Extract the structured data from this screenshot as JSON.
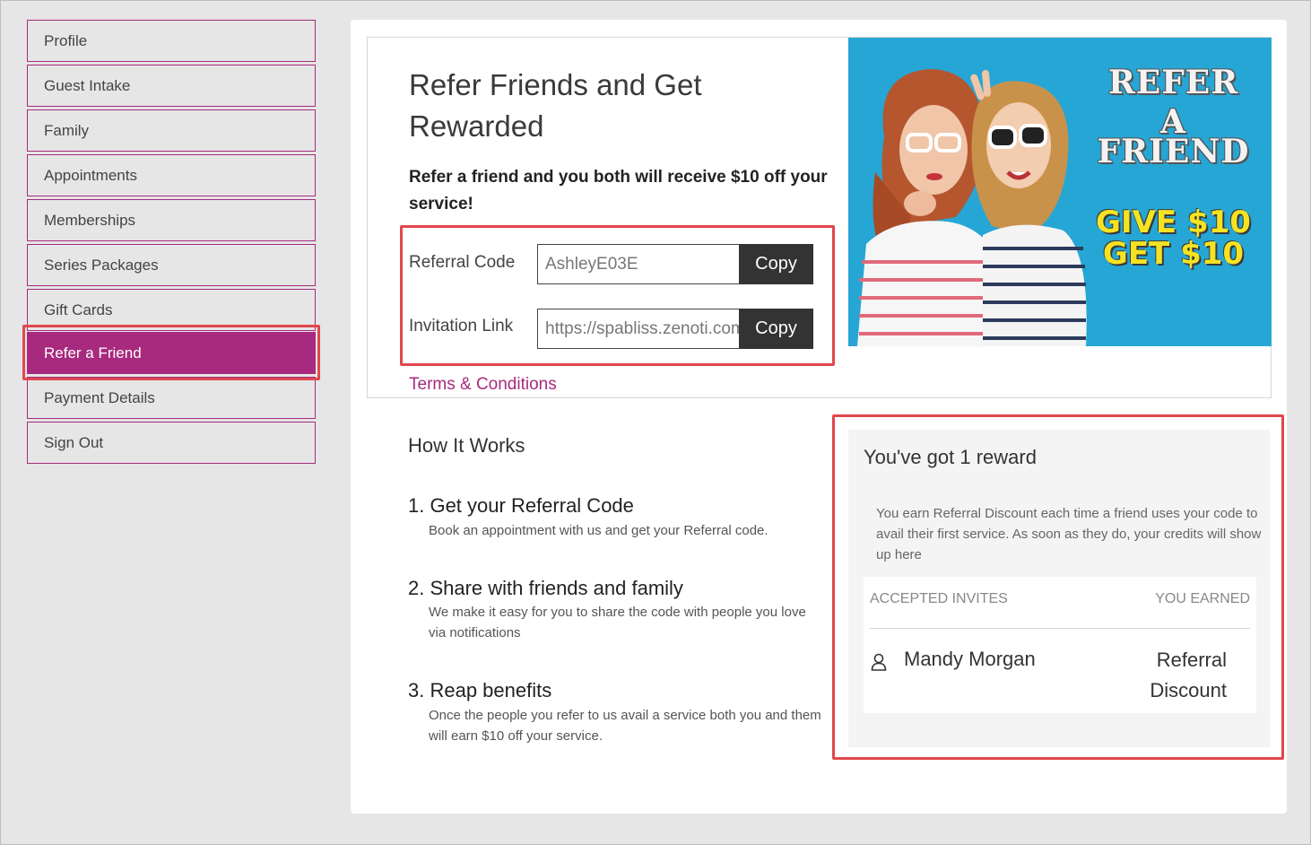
{
  "sidebar": {
    "items": [
      {
        "label": "Profile"
      },
      {
        "label": "Guest Intake"
      },
      {
        "label": "Family"
      },
      {
        "label": "Appointments"
      },
      {
        "label": "Memberships"
      },
      {
        "label": "Series Packages"
      },
      {
        "label": "Gift Cards"
      },
      {
        "label": "Refer a Friend",
        "active": true
      },
      {
        "label": "Payment Details"
      },
      {
        "label": "Sign Out"
      }
    ]
  },
  "refer": {
    "title": "Refer Friends and Get Rewarded",
    "subtitle": "Refer a friend and you both will receive $10 off your service!",
    "referral_code_label": "Referral Code",
    "referral_code_value": "AshleyE03E",
    "invitation_link_label": "Invitation Link",
    "invitation_link_value": "https://spabliss.zenoti.com",
    "copy_label": "Copy",
    "terms_label": "Terms & Conditions"
  },
  "promo": {
    "line1": "REFER",
    "line2": "A",
    "line3": "FRIEND",
    "give": "GIVE $10",
    "get": "GET $10"
  },
  "how": {
    "title": "How It Works",
    "steps": [
      {
        "title": "1. Get your Referral Code",
        "desc": "Book an appointment with us and get your Referral code."
      },
      {
        "title": "2. Share with friends and family",
        "desc": "We make it easy for you to share the code with people you love via notifications"
      },
      {
        "title": "3. Reap benefits",
        "desc": "Once the people you refer to us avail a service both you and them will earn $10 off your service."
      }
    ]
  },
  "reward": {
    "title": "You've got 1 reward",
    "description": "You earn Referral Discount each time a friend uses your code to avail their first service. As soon as they do, your credits will show up here",
    "col_accepted": "ACCEPTED INVITES",
    "col_earned": "YOU EARNED",
    "rows": [
      {
        "name": "Mandy Morgan",
        "earned": "Referral Discount"
      }
    ]
  },
  "colors": {
    "accent": "#a72a7e",
    "highlight": "#e0474c",
    "promo_bg": "#26a6d5"
  }
}
